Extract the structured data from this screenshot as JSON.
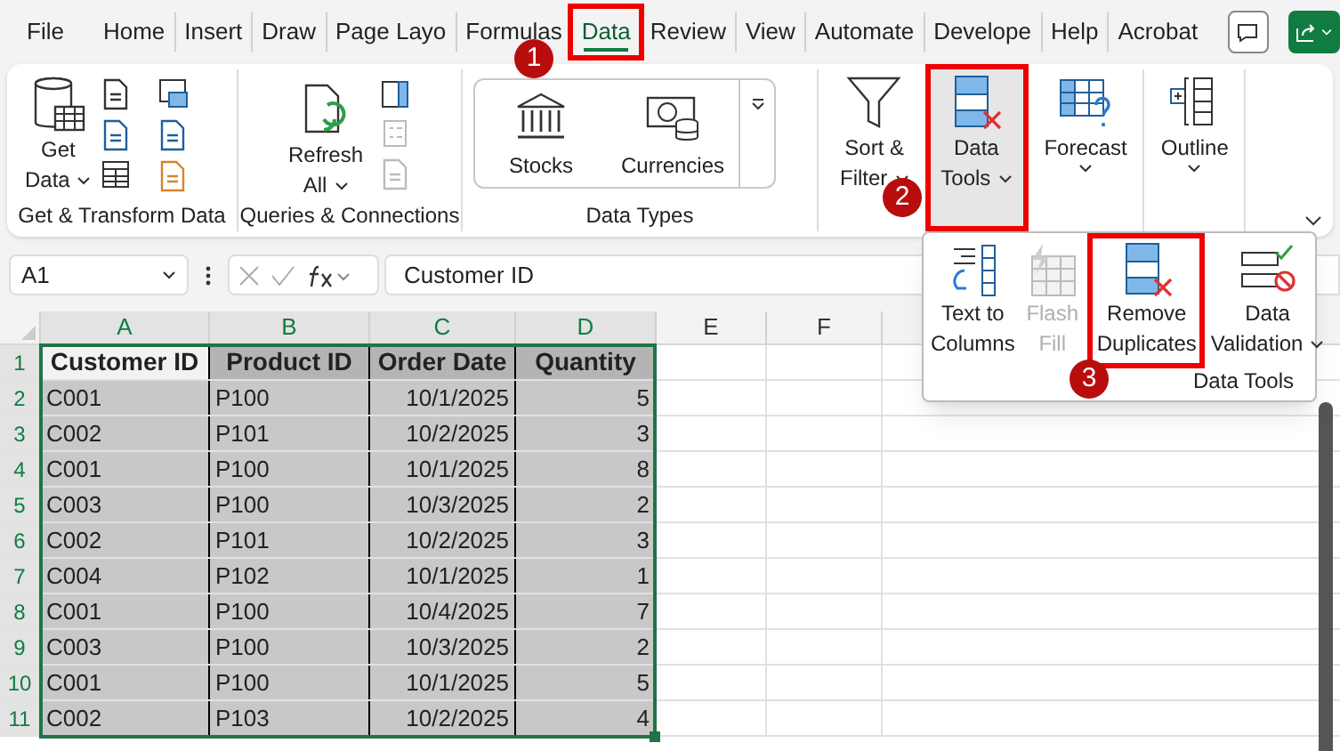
{
  "tabs": [
    {
      "label": "File",
      "selected": false,
      "outlined": false
    },
    {
      "label": "Home",
      "selected": false,
      "outlined": false
    },
    {
      "label": "Insert",
      "selected": false,
      "outlined": false
    },
    {
      "label": "Draw",
      "selected": false,
      "outlined": false
    },
    {
      "label": "Page Layo",
      "selected": false,
      "outlined": false
    },
    {
      "label": "Formulas",
      "selected": false,
      "outlined": false
    },
    {
      "label": "Data",
      "selected": true,
      "outlined": true
    },
    {
      "label": "Review",
      "selected": false,
      "outlined": false
    },
    {
      "label": "View",
      "selected": false,
      "outlined": false
    },
    {
      "label": "Automate",
      "selected": false,
      "outlined": false
    },
    {
      "label": "Develope",
      "selected": false,
      "outlined": false
    },
    {
      "label": "Help",
      "selected": false,
      "outlined": false
    },
    {
      "label": "Acrobat",
      "selected": false,
      "outlined": false
    }
  ],
  "ribbon": {
    "groups": [
      {
        "label": "Get & Transform Data",
        "buttons": [
          {
            "lines": [
              "Get",
              "Data"
            ]
          }
        ]
      },
      {
        "label": "Queries & Connections",
        "buttons": [
          {
            "lines": [
              "Refresh",
              "All"
            ]
          }
        ]
      },
      {
        "label": "Data Types",
        "buttons": [
          {
            "lines": [
              "Stocks"
            ]
          },
          {
            "lines": [
              "Currencies"
            ]
          }
        ]
      },
      {
        "buttons": [
          {
            "lines": [
              "Sort &",
              "Filter"
            ],
            "pressed": false,
            "outlined": false
          }
        ]
      },
      {
        "buttons": [
          {
            "lines": [
              "Data",
              "Tools"
            ],
            "pressed": true,
            "outlined": true
          }
        ]
      },
      {
        "buttons": [
          {
            "lines": [
              "Forecast"
            ],
            "pressed": false,
            "outlined": false
          }
        ]
      },
      {
        "buttons": [
          {
            "lines": [
              "Outline"
            ],
            "pressed": false,
            "outlined": false
          }
        ]
      }
    ]
  },
  "dropdown": {
    "label": "Data Tools",
    "items": [
      {
        "lines": [
          "Text to",
          "Columns"
        ],
        "disabled": false,
        "outlined": false
      },
      {
        "lines": [
          "Flash",
          "Fill"
        ],
        "disabled": true,
        "outlined": false
      },
      {
        "lines": [
          "Remove",
          "Duplicates"
        ],
        "disabled": false,
        "outlined": true
      },
      {
        "lines": [
          "Data",
          "Validation"
        ],
        "disabled": false,
        "outlined": false
      }
    ]
  },
  "name_box": "A1",
  "formula": "Customer ID",
  "columns": [
    "A",
    "B",
    "C",
    "D",
    "E",
    "F"
  ],
  "rows": [
    {
      "number": "1",
      "cells": [
        "Customer ID",
        "Product ID",
        "Order Date",
        "Quantity"
      ]
    },
    {
      "number": "2",
      "cells": [
        "C001",
        "P100",
        "10/1/2025",
        "5"
      ]
    },
    {
      "number": "3",
      "cells": [
        "C002",
        "P101",
        "10/2/2025",
        "3"
      ]
    },
    {
      "number": "4",
      "cells": [
        "C001",
        "P100",
        "10/1/2025",
        "8"
      ]
    },
    {
      "number": "5",
      "cells": [
        "C003",
        "P100",
        "10/3/2025",
        "2"
      ]
    },
    {
      "number": "6",
      "cells": [
        "C002",
        "P101",
        "10/2/2025",
        "3"
      ]
    },
    {
      "number": "7",
      "cells": [
        "C004",
        "P102",
        "10/1/2025",
        "1"
      ]
    },
    {
      "number": "8",
      "cells": [
        "C001",
        "P100",
        "10/4/2025",
        "7"
      ]
    },
    {
      "number": "9",
      "cells": [
        "C003",
        "P100",
        "10/3/2025",
        "2"
      ]
    },
    {
      "number": "10",
      "cells": [
        "C001",
        "P100",
        "10/1/2025",
        "5"
      ]
    },
    {
      "number": "11",
      "cells": [
        "C002",
        "P103",
        "10/2/2025",
        "4"
      ]
    }
  ],
  "callouts": [
    "1",
    "2",
    "3"
  ]
}
